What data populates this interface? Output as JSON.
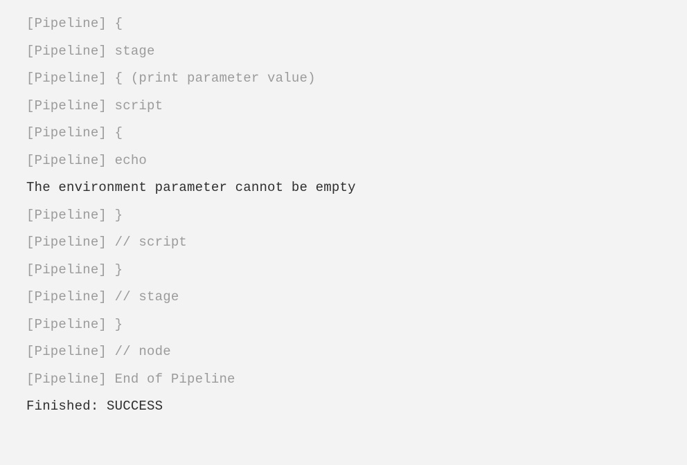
{
  "console": {
    "lines": [
      {
        "text": "[Pipeline] {",
        "kind": "pipeline"
      },
      {
        "text": "[Pipeline] stage",
        "kind": "pipeline"
      },
      {
        "text": "[Pipeline] { (print parameter value)",
        "kind": "pipeline"
      },
      {
        "text": "[Pipeline] script",
        "kind": "pipeline"
      },
      {
        "text": "[Pipeline] {",
        "kind": "pipeline"
      },
      {
        "text": "[Pipeline] echo",
        "kind": "pipeline"
      },
      {
        "text": "The environment parameter cannot be empty",
        "kind": "normal"
      },
      {
        "text": "[Pipeline] }",
        "kind": "pipeline"
      },
      {
        "text": "[Pipeline] // script",
        "kind": "pipeline"
      },
      {
        "text": "[Pipeline] }",
        "kind": "pipeline"
      },
      {
        "text": "[Pipeline] // stage",
        "kind": "pipeline"
      },
      {
        "text": "[Pipeline] }",
        "kind": "pipeline"
      },
      {
        "text": "[Pipeline] // node",
        "kind": "pipeline"
      },
      {
        "text": "[Pipeline] End of Pipeline",
        "kind": "pipeline"
      },
      {
        "text": "Finished: SUCCESS",
        "kind": "normal"
      }
    ]
  }
}
